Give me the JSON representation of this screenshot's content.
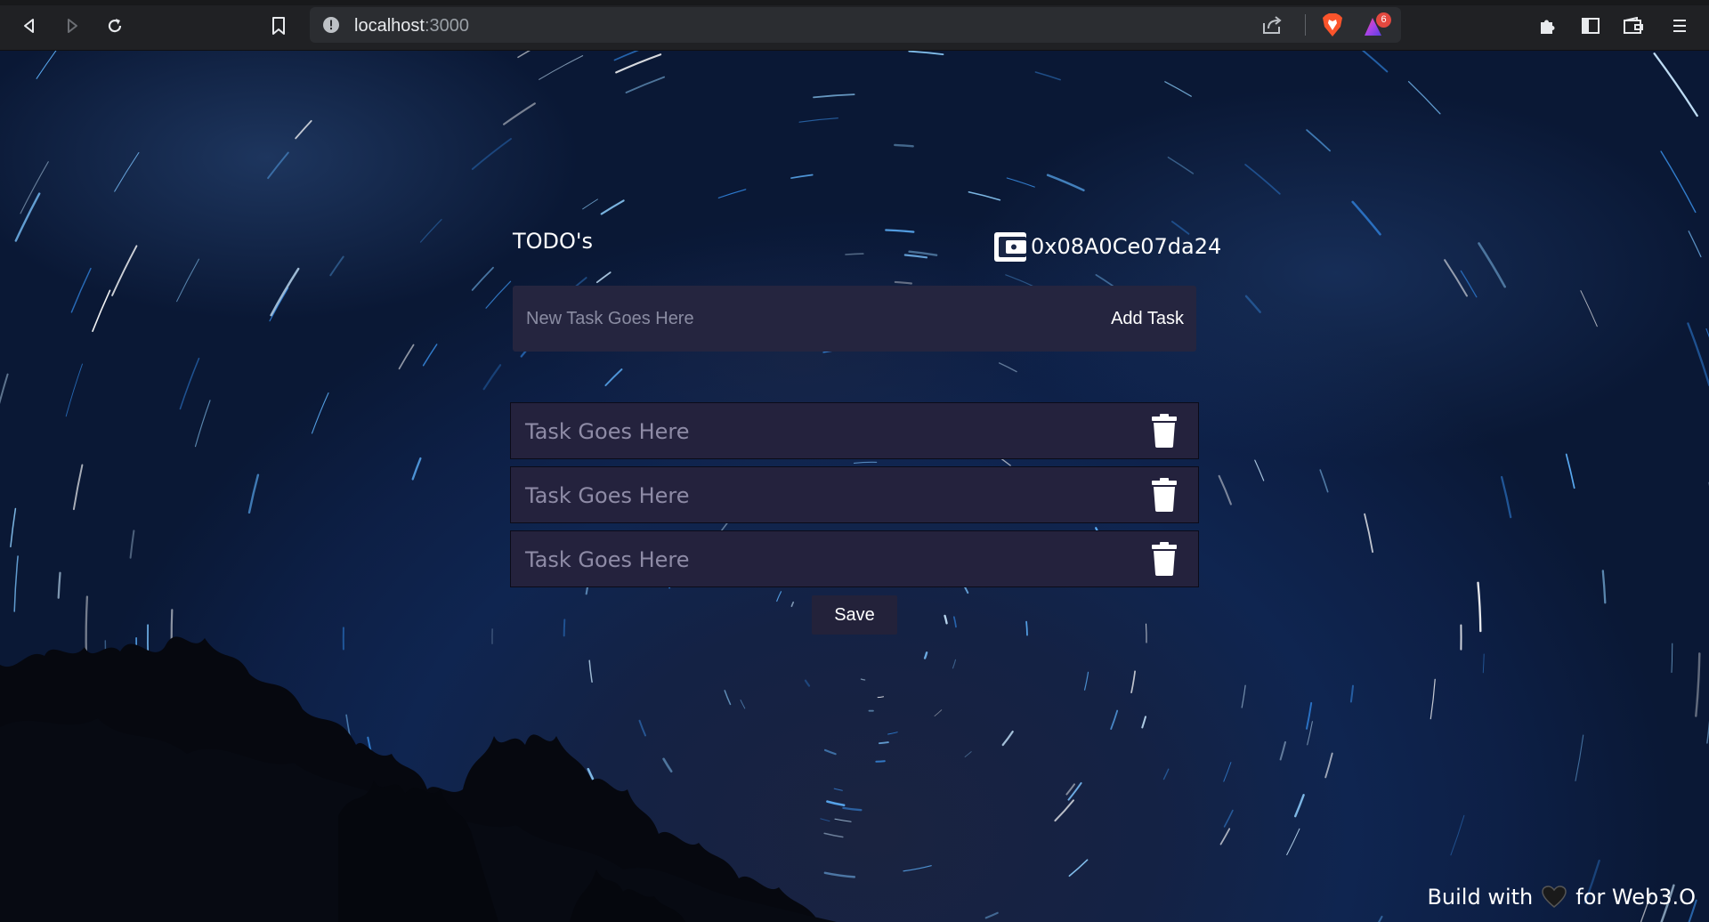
{
  "browser": {
    "url_host": "localhost",
    "url_port": ":3000",
    "rewards_badge_count": "6"
  },
  "app": {
    "title": "TODO's",
    "wallet_address": "0x08A0Ce07da24",
    "new_task": {
      "placeholder": "New Task Goes Here",
      "value": "",
      "add_label": "Add Task"
    },
    "tasks": [
      {
        "text": "Task Goes Here"
      },
      {
        "text": "Task Goes Here"
      },
      {
        "text": "Task Goes Here"
      }
    ],
    "save_label": "Save"
  },
  "footer": {
    "prefix": "Build with",
    "suffix": "for Web3.O"
  },
  "icons": {
    "back": "back-arrow-icon",
    "forward": "forward-arrow-icon",
    "reload": "reload-icon",
    "bookmark": "bookmark-icon",
    "site_info": "info-icon",
    "share": "share-icon",
    "brave_shields": "brave-lion-icon",
    "brave_rewards": "rewards-triangle-icon",
    "extensions": "puzzle-icon",
    "sidebar": "sidebar-icon",
    "wallet_chrome": "wallet-icon",
    "menu": "hamburger-menu-icon",
    "app_wallet": "wallet-icon",
    "delete": "trash-icon",
    "heart": "heart-icon"
  },
  "colors": {
    "panel": "#25253f",
    "task_row": "#24223d",
    "task_text": "#8e8ba6",
    "chrome_bg": "#202124"
  }
}
